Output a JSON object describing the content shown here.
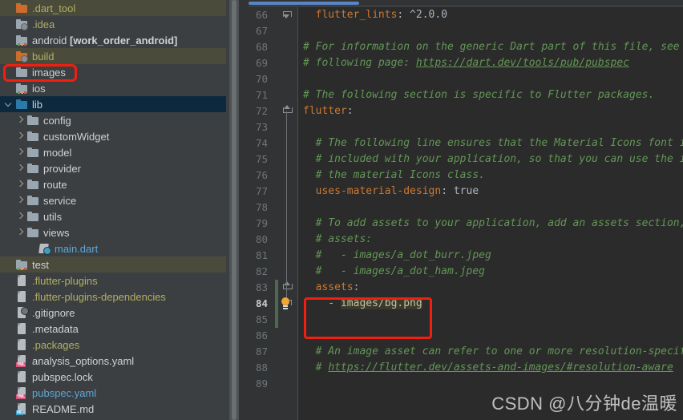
{
  "sidebar": {
    "items": [
      {
        "label": ".dart_tool",
        "icon": "folder-orange-icon",
        "arrow": "none",
        "indent": 0,
        "color": "olive",
        "row_bg": "olive",
        "bold": false
      },
      {
        "label": ".idea",
        "icon": "folder-cog-icon",
        "arrow": "none",
        "indent": 0,
        "color": "olive",
        "row_bg": "none",
        "bold": false
      },
      {
        "label": "android [work_order_android]",
        "icon": "folder-module-icon",
        "arrow": "none",
        "indent": 0,
        "color": "white",
        "row_bg": "none",
        "bold": false
      },
      {
        "label": "build",
        "icon": "folder-cog-orange-icon",
        "arrow": "none",
        "indent": 0,
        "color": "olive",
        "row_bg": "olive",
        "bold": false
      },
      {
        "label": "images",
        "icon": "folder-icon",
        "arrow": "none",
        "indent": 0,
        "color": "white",
        "row_bg": "none",
        "bold": false
      },
      {
        "label": "ios",
        "icon": "folder-module-icon",
        "arrow": "none",
        "indent": 0,
        "color": "white",
        "row_bg": "none",
        "bold": false
      },
      {
        "label": "lib",
        "icon": "folder-blue-icon",
        "arrow": "open",
        "indent": 0,
        "color": "white",
        "row_bg": "blue",
        "bold": false
      },
      {
        "label": "config",
        "icon": "folder-icon",
        "arrow": "closed",
        "indent": 1,
        "color": "white",
        "row_bg": "none",
        "bold": false
      },
      {
        "label": "customWidget",
        "icon": "folder-icon",
        "arrow": "closed",
        "indent": 1,
        "color": "white",
        "row_bg": "none",
        "bold": false
      },
      {
        "label": "model",
        "icon": "folder-icon",
        "arrow": "closed",
        "indent": 1,
        "color": "white",
        "row_bg": "none",
        "bold": false
      },
      {
        "label": "provider",
        "icon": "folder-icon",
        "arrow": "closed",
        "indent": 1,
        "color": "white",
        "row_bg": "none",
        "bold": false
      },
      {
        "label": "route",
        "icon": "folder-icon",
        "arrow": "closed",
        "indent": 1,
        "color": "white",
        "row_bg": "none",
        "bold": false
      },
      {
        "label": "service",
        "icon": "folder-icon",
        "arrow": "closed",
        "indent": 1,
        "color": "white",
        "row_bg": "none",
        "bold": false
      },
      {
        "label": "utils",
        "icon": "folder-icon",
        "arrow": "closed",
        "indent": 1,
        "color": "white",
        "row_bg": "none",
        "bold": false
      },
      {
        "label": "views",
        "icon": "folder-icon",
        "arrow": "closed",
        "indent": 1,
        "color": "white",
        "row_bg": "none",
        "bold": false
      },
      {
        "label": "main.dart",
        "icon": "dart-file-icon",
        "arrow": "none",
        "indent": 2,
        "color": "blue",
        "row_bg": "none",
        "bold": false
      },
      {
        "label": "test",
        "icon": "folder-module-icon",
        "arrow": "none",
        "indent": 0,
        "color": "white",
        "row_bg": "olive",
        "bold": false
      },
      {
        "label": ".flutter-plugins",
        "icon": "file-icon",
        "arrow": "none",
        "indent": 0,
        "color": "olive",
        "row_bg": "none",
        "bold": false
      },
      {
        "label": ".flutter-plugins-dependencies",
        "icon": "file-icon",
        "arrow": "none",
        "indent": 0,
        "color": "olive",
        "row_bg": "none",
        "bold": false
      },
      {
        "label": ".gitignore",
        "icon": "gitignore-file-icon",
        "arrow": "none",
        "indent": 0,
        "color": "white",
        "row_bg": "none",
        "bold": false
      },
      {
        "label": ".metadata",
        "icon": "file-icon",
        "arrow": "none",
        "indent": 0,
        "color": "white",
        "row_bg": "none",
        "bold": false
      },
      {
        "label": ".packages",
        "icon": "file-icon",
        "arrow": "none",
        "indent": 0,
        "color": "olive",
        "row_bg": "none",
        "bold": false
      },
      {
        "label": "analysis_options.yaml",
        "icon": "yaml-file-icon",
        "arrow": "none",
        "indent": 0,
        "color": "white",
        "row_bg": "none",
        "bold": false
      },
      {
        "label": "pubspec.lock",
        "icon": "file-icon",
        "arrow": "none",
        "indent": 0,
        "color": "white",
        "row_bg": "none",
        "bold": false
      },
      {
        "label": "pubspec.yaml",
        "icon": "yaml-file-icon",
        "arrow": "none",
        "indent": 0,
        "color": "blue",
        "row_bg": "none",
        "bold": false
      },
      {
        "label": "README.md",
        "icon": "md-file-icon",
        "arrow": "none",
        "indent": 0,
        "color": "white",
        "row_bg": "none",
        "bold": false
      }
    ],
    "annotation": {
      "target": "images",
      "color": "#f21f0e"
    }
  },
  "editor": {
    "gutter": {
      "first_line": 66,
      "current_line": 84,
      "line_numbers": [
        66,
        67,
        68,
        69,
        70,
        71,
        72,
        73,
        74,
        75,
        76,
        77,
        78,
        79,
        80,
        81,
        82,
        83,
        84,
        85,
        86,
        87,
        88,
        89
      ]
    },
    "lines": [
      {
        "n": 66,
        "segments": [
          {
            "t": "  ",
            "c": "plain"
          },
          {
            "t": "flutter_lints",
            "c": "key"
          },
          {
            "t": ":",
            "c": "plain"
          },
          {
            "t": " ^2.0.0",
            "c": "num"
          }
        ],
        "fold": "end"
      },
      {
        "n": 67,
        "segments": []
      },
      {
        "n": 68,
        "segments": [
          {
            "t": "# For information on the generic Dart part of this file, see t",
            "c": "com"
          }
        ]
      },
      {
        "n": 69,
        "segments": [
          {
            "t": "# following page: ",
            "c": "com"
          },
          {
            "t": "https://dart.dev/tools/pub/pubspec",
            "c": "link"
          }
        ]
      },
      {
        "n": 70,
        "segments": []
      },
      {
        "n": 71,
        "segments": [
          {
            "t": "# The following section is specific to Flutter packages.",
            "c": "com"
          }
        ]
      },
      {
        "n": 72,
        "segments": [
          {
            "t": "flutter",
            "c": "key"
          },
          {
            "t": ":",
            "c": "plain"
          }
        ],
        "fold": "open"
      },
      {
        "n": 73,
        "segments": []
      },
      {
        "n": 74,
        "segments": [
          {
            "t": "  # The following line ensures that the Material Icons font is",
            "c": "com"
          }
        ]
      },
      {
        "n": 75,
        "segments": [
          {
            "t": "  # included with your application, so that you can use the ic",
            "c": "com"
          }
        ]
      },
      {
        "n": 76,
        "segments": [
          {
            "t": "  # the material Icons class.",
            "c": "com"
          }
        ]
      },
      {
        "n": 77,
        "segments": [
          {
            "t": "  ",
            "c": "plain"
          },
          {
            "t": "uses-material-design",
            "c": "key"
          },
          {
            "t": ": ",
            "c": "plain"
          },
          {
            "t": "true",
            "c": "true"
          }
        ]
      },
      {
        "n": 78,
        "segments": []
      },
      {
        "n": 79,
        "segments": [
          {
            "t": "  # To add assets to your application, add an assets section,",
            "c": "com"
          }
        ]
      },
      {
        "n": 80,
        "segments": [
          {
            "t": "  # assets:",
            "c": "com"
          }
        ]
      },
      {
        "n": 81,
        "segments": [
          {
            "t": "  #   - images/a_dot_burr.jpeg",
            "c": "com"
          }
        ]
      },
      {
        "n": 82,
        "segments": [
          {
            "t": "  #   - images/a_dot_ham.jpeg",
            "c": "com"
          }
        ]
      },
      {
        "n": 83,
        "segments": [
          {
            "t": "  ",
            "c": "plain"
          },
          {
            "t": "assets",
            "c": "key"
          },
          {
            "t": ":",
            "c": "plain"
          }
        ],
        "fold": "open"
      },
      {
        "n": 84,
        "segments": [
          {
            "t": "    - ",
            "c": "plain"
          },
          {
            "t": "images/bg.png",
            "c": "str-hl"
          }
        ],
        "fold": "end",
        "bulb": true
      },
      {
        "n": 85,
        "segments": []
      },
      {
        "n": 86,
        "segments": []
      },
      {
        "n": 87,
        "segments": [
          {
            "t": "  # An image asset can refer to one or more resolution-specifi",
            "c": "com"
          }
        ]
      },
      {
        "n": 88,
        "segments": [
          {
            "t": "  # ",
            "c": "com"
          },
          {
            "t": "https://flutter.dev/assets-and-images/#resolution-aware",
            "c": "link"
          }
        ]
      },
      {
        "n": 89,
        "segments": []
      }
    ],
    "annotation": {
      "target": "assets-block",
      "color": "#f21f0e"
    }
  },
  "watermark": {
    "text": "CSDN @八分钟de温暖"
  },
  "colors": {
    "sidebar_bg": "#3c3f41",
    "editor_bg": "#2b2b2b",
    "gutter_bg": "#313335",
    "selection_blue": "#0d293e",
    "highlight_olive": "#4b4b3b",
    "annotation_red": "#f21f0e",
    "keyword_orange": "#cc7832",
    "comment_green": "#629755",
    "scrollbar_blue": "#5a85c4"
  }
}
